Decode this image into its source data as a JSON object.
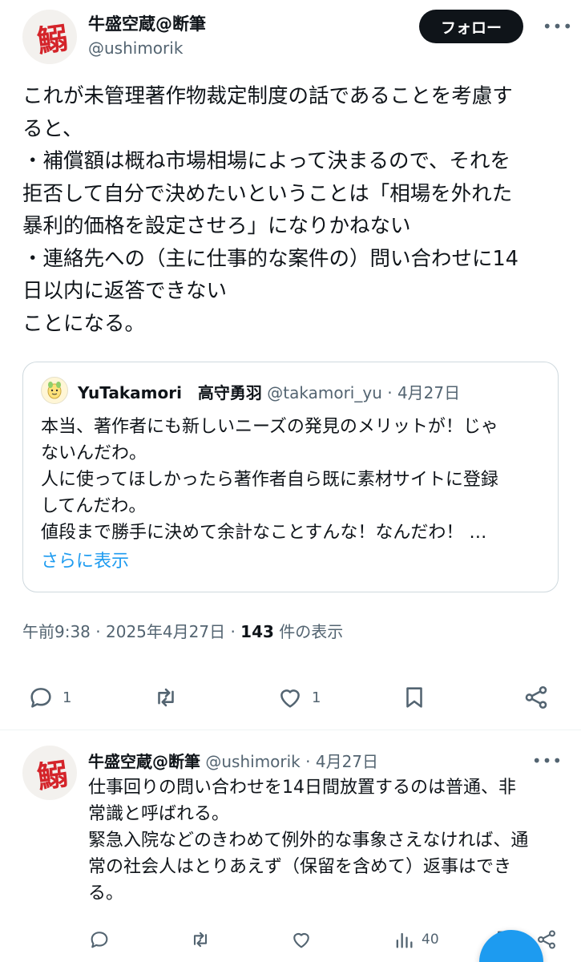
{
  "post": {
    "author_name": "牛盛空蔵@断筆",
    "author_handle": "@ushimorik",
    "follow_label": "フォロー",
    "more_label": "•••",
    "avatar_glyph": "鰯",
    "text": "これが未管理著作物裁定制度の話であることを考慮す\nると、\n・補償額は概ね市場相場によって決まるので、それを\n拒否して自分で決めたいということは「相場を外れた\n暴利的価格を設定させろ」になりかねない\n・連絡先への（主に仕事的な案件の）問い合わせに14\n日以内に返答できない\nことになる。",
    "time": "午前9:38",
    "date": "2025年4月27日",
    "views_count": "143",
    "views_label": "件の表示",
    "actions": {
      "reply_icon": "reply-icon",
      "reply_count": "1",
      "repost_icon": "repost-icon",
      "like_icon": "like-icon",
      "like_count": "1",
      "bookmark_icon": "bookmark-icon",
      "share_icon": "share-icon"
    }
  },
  "quote": {
    "name": "YuTakamori　高守勇羽",
    "handle": "@takamori_yu",
    "date": "4月27日",
    "text": "本当、著作者にも新しいニーズの発見のメリットが！じゃ\nないんだわ。\n人に使ってほしかったら著作者自ら既に素材サイトに登録\nしてんだわ。\n値段まで勝手に決めて余計なことすんな！なんだわ！ …",
    "show_more": "さらに表示"
  },
  "reply": {
    "author_name": "牛盛空蔵@断筆",
    "author_handle": "@ushimorik",
    "date": "4月27日",
    "avatar_glyph": "鰯",
    "more_label": "•••",
    "text": "仕事回りの問い合わせを14日間放置するのは普通、非\n常識と呼ばれる。\n緊急入院などのきわめて例外的な事象さえなければ、通\n常の社会人はとりあえず（保留を含めて）返事はでき\nる。",
    "views_count": "40"
  },
  "colors": {
    "accent": "#1d9bf0",
    "text": "#0f1419",
    "secondary": "#536471",
    "border": "#cfd9de",
    "avatar_glyph": "#d4242a"
  }
}
